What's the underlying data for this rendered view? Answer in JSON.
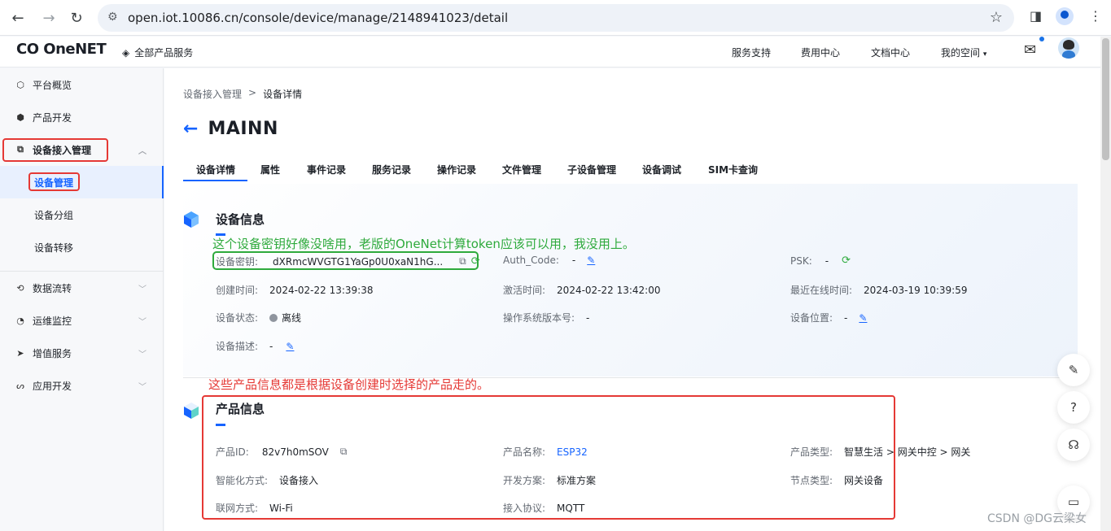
{
  "browser": {
    "url": "open.iot.10086.cn/console/device/manage/2148941023/detail"
  },
  "header": {
    "logo": "OneNET",
    "all_products": "全部产品服务",
    "links": [
      "服务支持",
      "费用中心",
      "文档中心",
      "我的空间"
    ]
  },
  "sidebar": {
    "items": [
      {
        "label": "平台概览",
        "icon": "dashboard-icon"
      },
      {
        "label": "产品开发",
        "icon": "cube-icon"
      },
      {
        "label": "设备接入管理",
        "icon": "device-icon"
      },
      {
        "label": "数据流转",
        "icon": "flow-icon"
      },
      {
        "label": "运维监控",
        "icon": "monitor-icon"
      },
      {
        "label": "增值服务",
        "icon": "send-icon"
      },
      {
        "label": "应用开发",
        "icon": "app-icon"
      }
    ],
    "sub_items": [
      "设备管理",
      "设备分组",
      "设备转移"
    ]
  },
  "breadcrumb": {
    "parent": "设备接入管理",
    "sep": ">",
    "current": "设备详情"
  },
  "device": {
    "name": "MAINN"
  },
  "tabs": [
    "设备详情",
    "属性",
    "事件记录",
    "服务记录",
    "操作记录",
    "文件管理",
    "子设备管理",
    "设备调试",
    "SIM卡查询"
  ],
  "device_info": {
    "title": "设备信息",
    "annotation": "这个设备密钥好像没啥用，老版的OneNet计算token应该可以用，我没用上。",
    "fields": {
      "key_label": "设备密钥:",
      "key_value": "dXRmcWVGTG1YaGp0U0xaN1hG...",
      "auth_label": "Auth_Code:",
      "auth_value": "-",
      "psk_label": "PSK:",
      "psk_value": "-",
      "created_label": "创建时间:",
      "created_value": "2024-02-22 13:39:38",
      "activated_label": "激活时间:",
      "activated_value": "2024-02-22 13:42:00",
      "online_label": "最近在线时间:",
      "online_value": "2024-03-19 10:39:59",
      "status_label": "设备状态:",
      "status_value": "离线",
      "os_label": "操作系统版本号:",
      "os_value": "-",
      "location_label": "设备位置:",
      "location_value": "-",
      "desc_label": "设备描述:",
      "desc_value": "-"
    }
  },
  "product_info": {
    "title": "产品信息",
    "annotation": "这些产品信息都是根据设备创建时选择的产品走的。",
    "fields": {
      "id_label": "产品ID:",
      "id_value": "82v7h0mSOV",
      "name_label": "产品名称:",
      "name_value": "ESP32",
      "type_label": "产品类型:",
      "type_value": "智慧生活 > 网关中控 > 网关",
      "smart_label": "智能化方式:",
      "smart_value": "设备接入",
      "dev_label": "开发方案:",
      "dev_value": "标准方案",
      "node_label": "节点类型:",
      "node_value": "网关设备",
      "net_label": "联网方式:",
      "net_value": "Wi-Fi",
      "proto_label": "接入协议:",
      "proto_value": "MQTT"
    }
  },
  "watermark": "CSDN @DG云梁女",
  "colors": {
    "accent": "#1664ff",
    "annotation_green": "#2eaa3c",
    "annotation_red": "#e53935"
  }
}
